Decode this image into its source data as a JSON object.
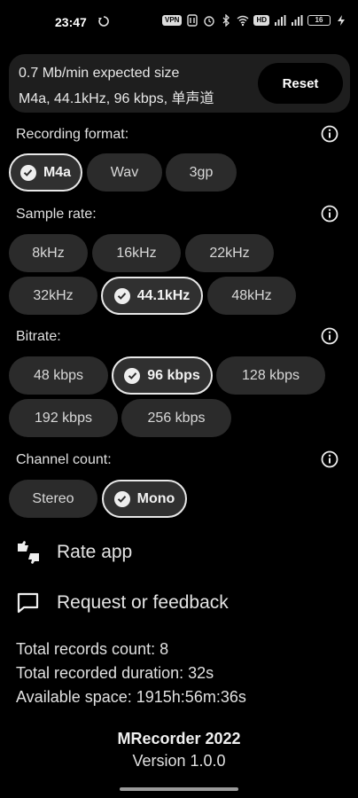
{
  "status_bar": {
    "time": "23:47",
    "pills": [
      "VPN",
      "HD"
    ],
    "battery": "16",
    "icons": [
      "sync-icon",
      "vpn-icon",
      "alarm-icon",
      "bluetooth-icon",
      "wifi-icon",
      "signal-icon",
      "signal-icon",
      "battery-icon",
      "charging-icon"
    ]
  },
  "info_card": {
    "line1": "0.7 Mb/min expected size",
    "line2": "M4a, 44.1kHz, 96 kbps, 单声道",
    "reset_label": "Reset"
  },
  "recording_format": {
    "label": "Recording format:",
    "options": [
      "M4a",
      "Wav",
      "3gp"
    ],
    "selected": "M4a"
  },
  "sample_rate": {
    "label": "Sample rate:",
    "options": [
      "8kHz",
      "16kHz",
      "22kHz",
      "32kHz",
      "44.1kHz",
      "48kHz"
    ],
    "selected": "44.1kHz"
  },
  "bitrate": {
    "label": "Bitrate:",
    "options": [
      "48 kbps",
      "96 kbps",
      "128 kbps",
      "192 kbps",
      "256 kbps"
    ],
    "selected": "96 kbps"
  },
  "channel_count": {
    "label": "Channel count:",
    "options": [
      "Stereo",
      "Mono"
    ],
    "selected": "Mono"
  },
  "menu": {
    "rate_app": "Rate app",
    "feedback": "Request or feedback"
  },
  "stats": {
    "records_count": "Total records count: 8",
    "recorded_duration": "Total recorded duration: 32s",
    "available_space": "Available space: 1915h:56m:36s"
  },
  "footer": {
    "title": "MRecorder 2022",
    "version": "Version 1.0.0"
  },
  "colors": {
    "background": "#000000",
    "chip": "#2b2b2b",
    "card": "#1e1e1e",
    "selected_border": "#e8e8e8"
  }
}
